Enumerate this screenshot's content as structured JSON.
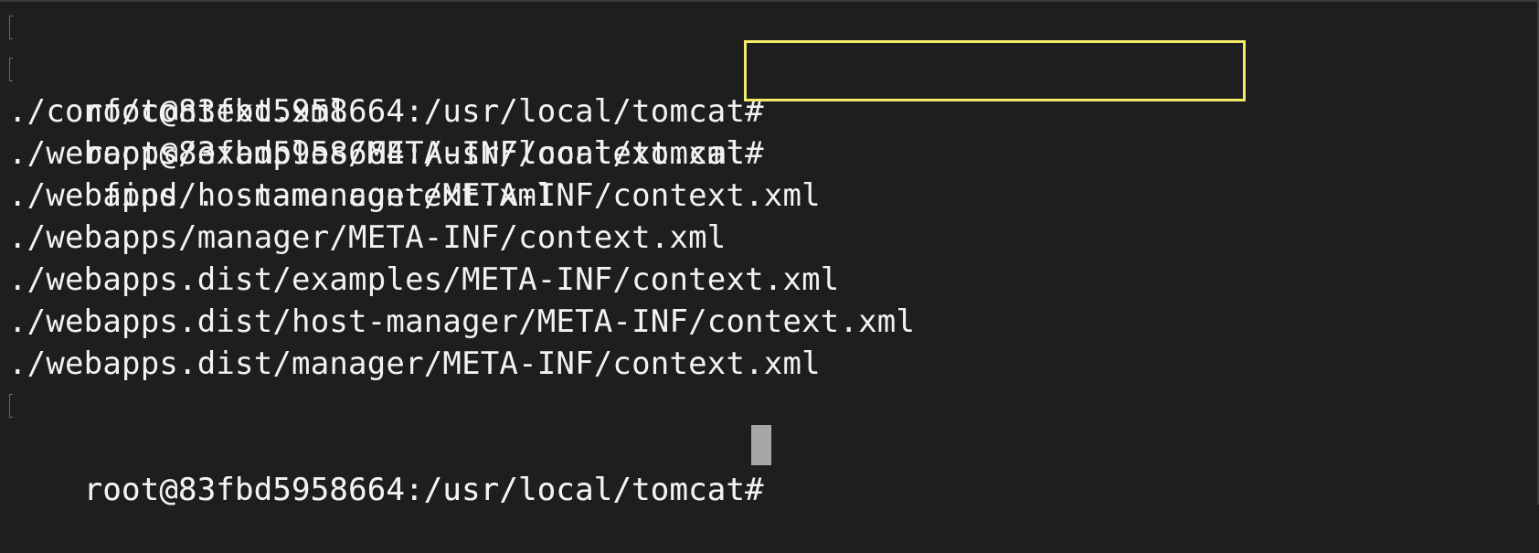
{
  "terminal": {
    "lines": [
      {
        "prompt": "root@83fbd5958664:/usr/local/tomcat#",
        "command": ""
      },
      {
        "prompt": "root@83fbd5958664:/usr/local/tomcat#",
        "command": "find . -name context.xml"
      },
      {
        "output": "./conf/context.xml"
      },
      {
        "output": "./webapps/examples/META-INF/context.xml"
      },
      {
        "output": "./webapps/host-manager/META-INF/context.xml"
      },
      {
        "output": "./webapps/manager/META-INF/context.xml"
      },
      {
        "output": "./webapps.dist/examples/META-INF/context.xml"
      },
      {
        "output": "./webapps.dist/host-manager/META-INF/context.xml"
      },
      {
        "output": "./webapps.dist/manager/META-INF/context.xml"
      },
      {
        "prompt": "root@83fbd5958664:/usr/local/tomcat#",
        "command": ""
      },
      {
        "prompt": "root@83fbd5958664:/usr/local/tomcat#",
        "command": ""
      }
    ],
    "highlight_color": "#f2e96b",
    "background_color": "#1e1e1e",
    "text_color": "#f2f2f2",
    "cursor_color": "#a7a7a7"
  }
}
